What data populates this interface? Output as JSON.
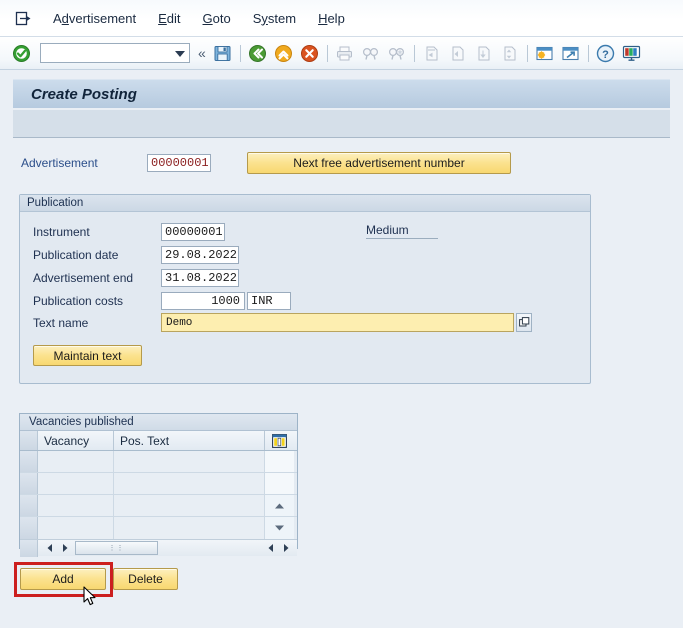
{
  "window": {
    "icon": "window-menu-icon"
  },
  "menu": {
    "items": [
      {
        "label": "Advertisement",
        "accel_index": 1,
        "name": "menu-advertisement"
      },
      {
        "label": "Edit",
        "accel_index": 0,
        "name": "menu-edit"
      },
      {
        "label": "Goto",
        "accel_index": 0,
        "name": "menu-goto"
      },
      {
        "label": "System",
        "accel_index": 1,
        "name": "menu-system"
      },
      {
        "label": "Help",
        "accel_index": 0,
        "name": "menu-help"
      }
    ]
  },
  "toolbar": {
    "command_field": {
      "value": "",
      "placeholder": ""
    },
    "icons": [
      "enter-check-icon",
      "expand-command-field-icon",
      "save-icon",
      "back-green-icon",
      "exit-yellow-icon",
      "cancel-red-icon",
      "print-icon",
      "find-icon",
      "find-next-icon",
      "first-page-icon",
      "previous-page-icon",
      "next-page-icon",
      "last-page-icon",
      "create-session-icon",
      "create-shortcut-icon",
      "help-icon",
      "customize-local-layout-icon"
    ]
  },
  "title": {
    "text": "Create Posting"
  },
  "advertisement": {
    "label": "Advertisement",
    "number": "00000001",
    "next_free_button": "Next free advertisement number"
  },
  "publication": {
    "group_title": "Publication",
    "medium_label": "Medium",
    "rows": [
      {
        "label": "Instrument",
        "value": "00000001",
        "name": "instrument"
      },
      {
        "label": "Publication date",
        "value": "29.08.2022",
        "name": "publication-date"
      },
      {
        "label": "Advertisement end",
        "value": "31.08.2022",
        "name": "advertisement-end"
      }
    ],
    "costs": {
      "label": "Publication costs",
      "amount": "1000",
      "currency": "INR"
    },
    "text_name": {
      "label": "Text name",
      "value": "Demo",
      "multi_select_icon": "multiple-selection-icon"
    },
    "maintain_text_button": "Maintain text"
  },
  "vacancies": {
    "title": "Vacancies published",
    "columns": [
      "Vacancy",
      "Pos. Text"
    ],
    "config_icon": "table-settings-icon",
    "rows": [
      {
        "vacancy": "",
        "pos_text": ""
      },
      {
        "vacancy": "",
        "pos_text": ""
      },
      {
        "vacancy": "",
        "pos_text": ""
      },
      {
        "vacancy": "",
        "pos_text": ""
      }
    ],
    "scroll": {
      "up_icon": "scroll-up-icon",
      "down_icon": "scroll-down-icon",
      "left_icon": "scroll-left-icon",
      "right_icon": "scroll-right-icon",
      "thumb_grip": "⋮⋮"
    }
  },
  "actions": {
    "add_button": "Add",
    "delete_button": "Delete"
  },
  "colors": {
    "accent_yellow": "#fbe28e",
    "highlight_red": "#cc1f1f",
    "title_blue": "#b6cadf",
    "body_bg": "#eaeff5",
    "field_value_red": "#8c2020",
    "link_blue": "#2b4e8a"
  }
}
